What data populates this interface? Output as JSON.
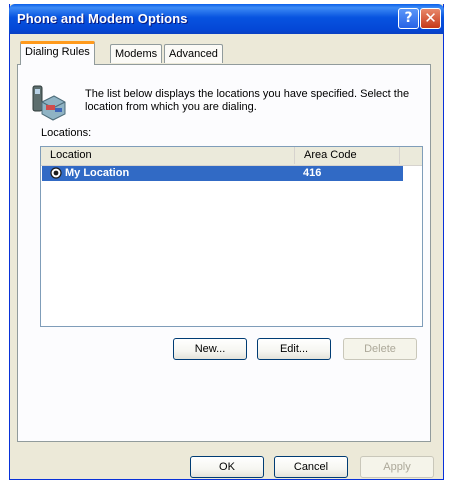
{
  "window": {
    "title": "Phone and Modem Options"
  },
  "titlebar": {
    "help_glyph": "?",
    "close_glyph": "✕"
  },
  "tabs": [
    {
      "label": "Dialing Rules",
      "active": true
    },
    {
      "label": "Modems",
      "active": false
    },
    {
      "label": "Advanced",
      "active": false
    }
  ],
  "dialing_rules": {
    "intro": "The list below displays the locations you have specified. Select the location from which you are dialing.",
    "locations_label": "Locations:",
    "columns": [
      "Location",
      "Area Code"
    ],
    "rows": [
      {
        "location": "My Location",
        "area_code": "416",
        "selected": true
      }
    ],
    "buttons": {
      "new": "New...",
      "edit": "Edit...",
      "delete": "Delete"
    }
  },
  "footer": {
    "ok": "OK",
    "cancel": "Cancel",
    "apply": "Apply"
  },
  "colors": {
    "selection": "#316ac5",
    "titlebar": "#0753e0",
    "tab_accent": "#ff9a1c"
  },
  "icons": [
    "help-icon",
    "close-icon",
    "phone-icon",
    "radio-selected-icon"
  ]
}
